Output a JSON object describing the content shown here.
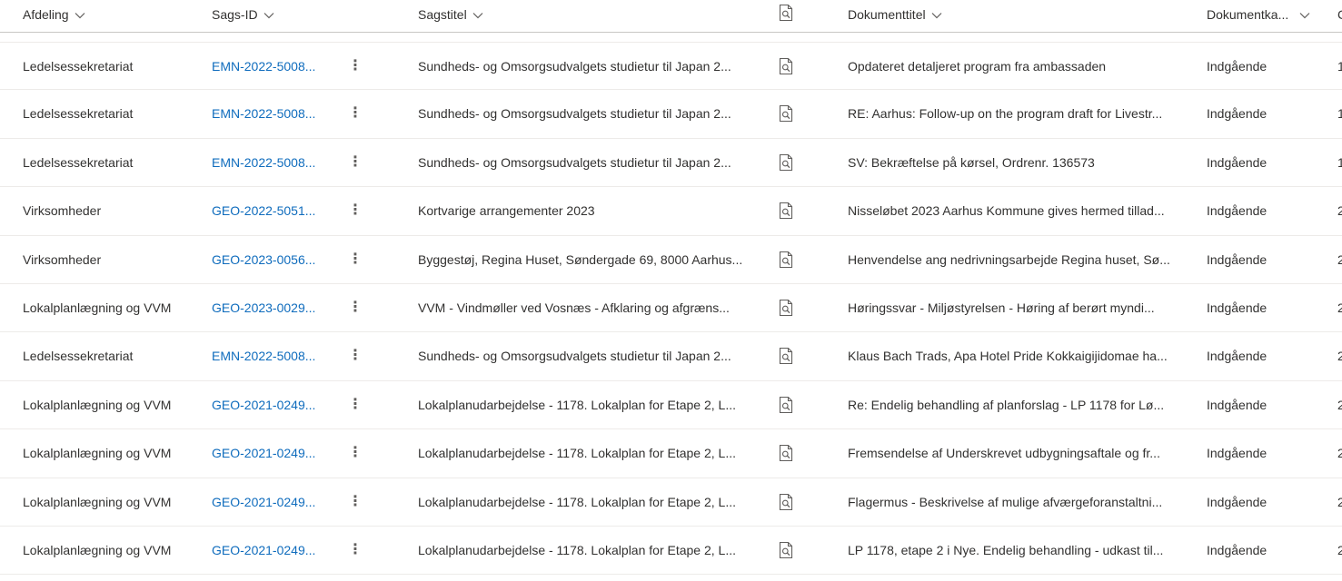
{
  "columns": {
    "afdeling": "Afdeling",
    "sags_id": "Sags-ID",
    "sagstitel": "Sagstitel",
    "preview_icon": "document-preview-icon",
    "dokumenttitel": "Dokumenttitel",
    "dokumentkategori": "Dokumentka...",
    "next": "C"
  },
  "more_glyph": "⋮",
  "rows": [
    {
      "afdeling": "Ledelsessekretariat",
      "sags_id": "EMN-2022-5008...",
      "sagstitel": "Sundheds- og Omsorgsudvalgets studietur til Japan 2...",
      "dokumenttitel": "Opdateret detaljeret program fra ambassaden",
      "kategori": "Indgående",
      "next": "1"
    },
    {
      "afdeling": "Ledelsessekretariat",
      "sags_id": "EMN-2022-5008...",
      "sagstitel": "Sundheds- og Omsorgsudvalgets studietur til Japan 2...",
      "dokumenttitel": "RE: Aarhus: Follow-up on the program draft for Livestr...",
      "kategori": "Indgående",
      "next": "1"
    },
    {
      "afdeling": "Ledelsessekretariat",
      "sags_id": "EMN-2022-5008...",
      "sagstitel": "Sundheds- og Omsorgsudvalgets studietur til Japan 2...",
      "dokumenttitel": "SV: Bekræftelse på kørsel, Ordrenr. 136573",
      "kategori": "Indgående",
      "next": "1"
    },
    {
      "afdeling": "Virksomheder",
      "sags_id": "GEO-2022-5051...",
      "sagstitel": "Kortvarige arrangementer 2023",
      "dokumenttitel": "Nisseløbet 2023 Aarhus Kommune gives hermed tillad...",
      "kategori": "Indgående",
      "next": "2"
    },
    {
      "afdeling": "Virksomheder",
      "sags_id": "GEO-2023-0056...",
      "sagstitel": "Byggestøj, Regina Huset, Søndergade 69, 8000 Aarhus...",
      "dokumenttitel": "Henvendelse ang nedrivningsarbejde Regina huset, Sø...",
      "kategori": "Indgående",
      "next": "2"
    },
    {
      "afdeling": "Lokalplanlægning og VVM",
      "sags_id": "GEO-2023-0029...",
      "sagstitel": "VVM - Vindmøller ved Vosnæs - Afklaring og afgræns...",
      "dokumenttitel": "Høringssvar - Miljøstyrelsen - Høring af berørt myndi...",
      "kategori": "Indgående",
      "next": "2"
    },
    {
      "afdeling": "Ledelsessekretariat",
      "sags_id": "EMN-2022-5008...",
      "sagstitel": "Sundheds- og Omsorgsudvalgets studietur til Japan 2...",
      "dokumenttitel": "Klaus Bach Trads, Apa Hotel Pride Kokkaigijidomae ha...",
      "kategori": "Indgående",
      "next": "2"
    },
    {
      "afdeling": "Lokalplanlægning og VVM",
      "sags_id": "GEO-2021-0249...",
      "sagstitel": "Lokalplanudarbejdelse - 1178. Lokalplan for Etape 2, L...",
      "dokumenttitel": "Re: Endelig behandling af planforslag - LP 1178 for Lø...",
      "kategori": "Indgående",
      "next": "2"
    },
    {
      "afdeling": "Lokalplanlægning og VVM",
      "sags_id": "GEO-2021-0249...",
      "sagstitel": "Lokalplanudarbejdelse - 1178. Lokalplan for Etape 2, L...",
      "dokumenttitel": "Fremsendelse af Underskrevet udbygningsaftale og fr...",
      "kategori": "Indgående",
      "next": "2"
    },
    {
      "afdeling": "Lokalplanlægning og VVM",
      "sags_id": "GEO-2021-0249...",
      "sagstitel": "Lokalplanudarbejdelse - 1178. Lokalplan for Etape 2, L...",
      "dokumenttitel": "Flagermus - Beskrivelse af mulige afværgeforanstaltni...",
      "kategori": "Indgående",
      "next": "2"
    },
    {
      "afdeling": "Lokalplanlægning og VVM",
      "sags_id": "GEO-2021-0249...",
      "sagstitel": "Lokalplanudarbejdelse - 1178. Lokalplan for Etape 2, L...",
      "dokumenttitel": "LP 1178, etape 2 i Nye. Endelig behandling - udkast til...",
      "kategori": "Indgående",
      "next": "2"
    }
  ]
}
